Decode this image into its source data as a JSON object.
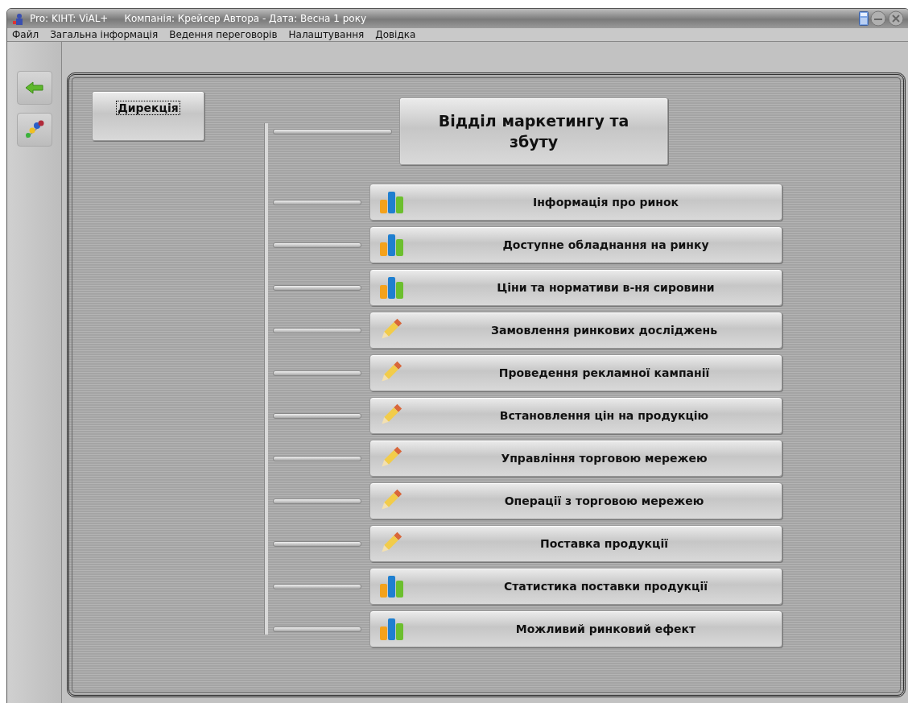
{
  "window": {
    "title": "Pro: KIHT: ViAL+",
    "subtitle": "Компанія: Крейсер Автора - Дата: Весна 1 року"
  },
  "menu": [
    "Файл",
    "Загальна інформація",
    "Ведення переговорів",
    "Налаштування",
    "Довідка"
  ],
  "direction_button": {
    "label": "Дирекція",
    "focused": true
  },
  "department": {
    "label": "Відділ маркетингу та збуту"
  },
  "items": [
    {
      "label": "Інформація про ринок",
      "kind": "chart"
    },
    {
      "label": "Доступне обладнання на ринку",
      "kind": "chart"
    },
    {
      "label": "Ціни та нормативи в-ня сировини",
      "kind": "chart"
    },
    {
      "label": "Замовлення ринкових досліджень",
      "kind": "pencil"
    },
    {
      "label": "Проведення рекламної кампанії",
      "kind": "pencil"
    },
    {
      "label": "Встановлення цін на продукцію",
      "kind": "pencil"
    },
    {
      "label": "Управління торговою мережею",
      "kind": "pencil"
    },
    {
      "label": "Операції з торговою мережею",
      "kind": "pencil"
    },
    {
      "label": "Поставка продукції",
      "kind": "pencil"
    },
    {
      "label": "Статистика поставки продукції",
      "kind": "chart"
    },
    {
      "label": "Можливий ринковий ефект",
      "kind": "chart"
    }
  ]
}
